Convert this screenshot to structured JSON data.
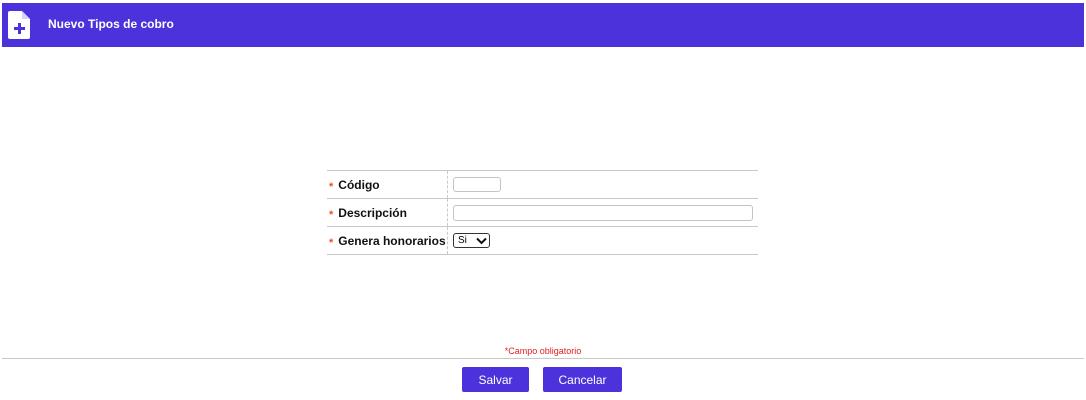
{
  "header": {
    "icon": "file-add-icon",
    "title": "Nuevo Tipos de cobro"
  },
  "form": {
    "required_marker": "*",
    "fields": [
      {
        "label": "Código",
        "type": "text",
        "value": ""
      },
      {
        "label": "Descripción",
        "type": "text",
        "value": ""
      },
      {
        "label": "Genera honorarios",
        "type": "select",
        "value": "Si",
        "options": [
          "Si"
        ]
      }
    ]
  },
  "footer": {
    "required_note": "*Campo obligatorio",
    "save_label": "Salvar",
    "cancel_label": "Cancelar"
  },
  "colors": {
    "accent": "#4b32da",
    "required": "#e8541a",
    "note": "#e02020"
  }
}
